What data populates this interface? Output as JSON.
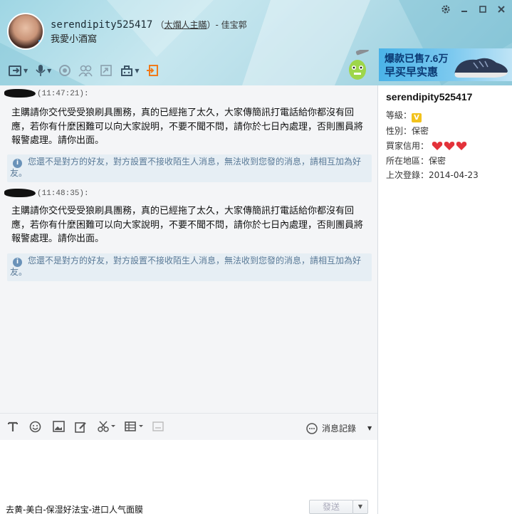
{
  "header": {
    "name": "serendipity525417",
    "tag": "太爛人主瞞",
    "shop": "佳宝郭",
    "signature": "我愛小酒窩",
    "window_controls": [
      "settings-icon",
      "minimize-icon",
      "maximize-icon",
      "close-icon"
    ]
  },
  "toolbar": {
    "icons": [
      "send-file-icon",
      "voice-icon",
      "video-icon",
      "group-icon",
      "screenshot-icon",
      "remote-assist-icon",
      "exit-chat-icon"
    ]
  },
  "ad": {
    "line1": "爆款已售7.6万",
    "line2": "早买早实惠"
  },
  "messages": [
    {
      "time": "(11:47:21):",
      "text": "主購請你交代受受狼刷具團務，真的已經拖了太久，大家傳簡訊打電話給你都沒有回應，若你有什麼困難可以向大家說明，不要不聞不問，請你於七日內處理，否則團員將報警處理。請你出面。",
      "notice": "您還不是對方的好友，對方設置不接收陌生人消息，無法收到您發的消息，請相互加為好友。"
    },
    {
      "time": "(11:48:35):",
      "text": "主購請你交代受受狼刷具團務，真的已經拖了太久，大家傳簡訊打電話給你都沒有回應，若你有什麼困難可以向大家說明，不要不聞不問，請你於七日內處理，否則團員將報警處理。請你出面。",
      "notice": "您還不是對方的好友，對方設置不接收陌生人消息，無法收到您發的消息，請相互加為好友。"
    }
  ],
  "profile": {
    "name": "serendipity525417",
    "level_label": "等級：",
    "gender": "性別：保密",
    "credit_label": "買家信用：",
    "region": "所在地區：保密",
    "last_login": "上次登錄：2014-04-23"
  },
  "input_toolbar": {
    "icons": [
      "font-icon",
      "emoji-icon",
      "image-icon",
      "edit-icon",
      "scissors-icon",
      "table-icon",
      "keyboard-icon"
    ],
    "history_label": "消息記錄"
  },
  "footer": {
    "ad_text": "去黄-美白-保湿好法宝-进口人气面膜",
    "send_label": "發送"
  },
  "colors": {
    "header_bg": "#b5dde8",
    "notice_bg": "#e6eef4",
    "notice_text": "#5a7a97",
    "ad_bg": "#4ab3e8",
    "ad_text": "#0b3a74"
  }
}
